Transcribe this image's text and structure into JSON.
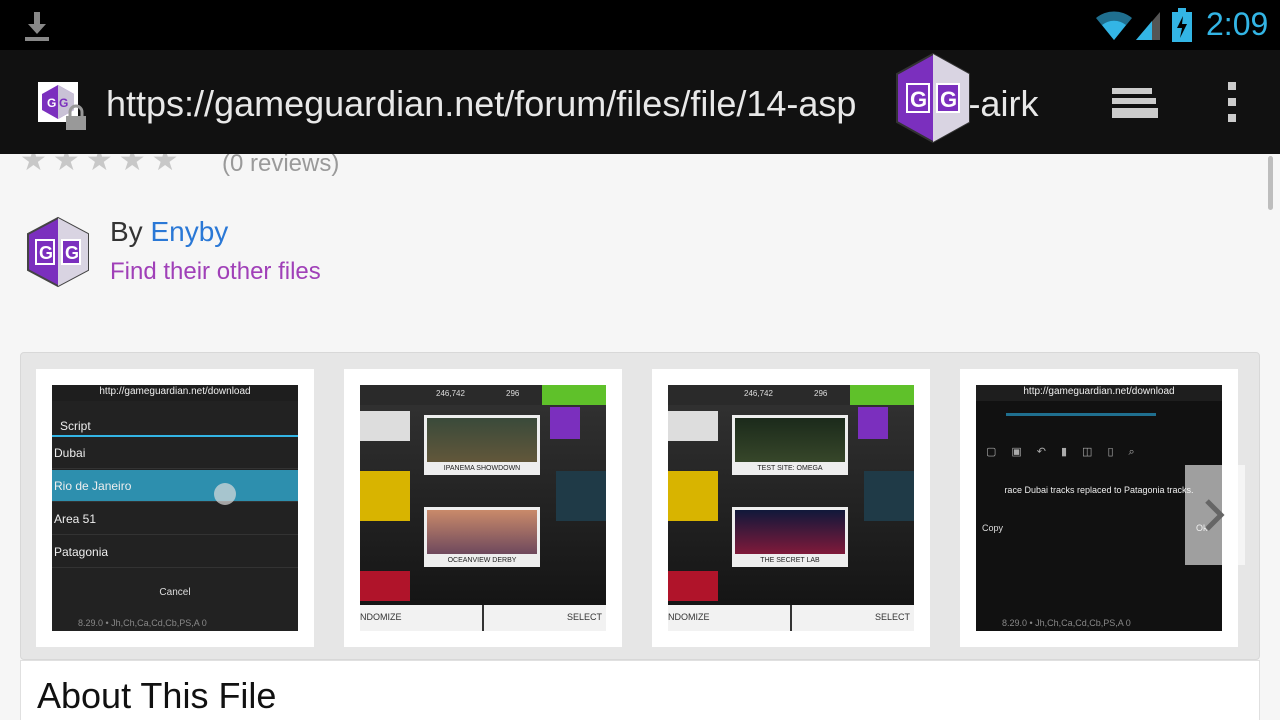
{
  "status_bar": {
    "time": "2:09",
    "icons": [
      "download-icon",
      "wifi-icon",
      "signal-icon",
      "battery-icon"
    ],
    "accent": "#33b5e5"
  },
  "browser": {
    "url": "https://gameguardian.net/forum/files/file/14-asp",
    "url_suffix": "8-airk",
    "icons": [
      "site-favicon",
      "lock-icon",
      "tabs-icon",
      "overflow-menu-icon",
      "gameguardian-overlay-icon"
    ]
  },
  "page": {
    "rating": {
      "stars": 5,
      "filled": 0,
      "reviews": "(0 reviews)"
    },
    "author": {
      "by": "By ",
      "name": "Enyby",
      "other_files": "Find their other files"
    },
    "gallery": {
      "screenshots": [
        {
          "type": "script-menu",
          "url": "http://gameguardian.net/download",
          "title": "Script",
          "items": [
            "Dubai",
            "Rio de Janeiro",
            "Area 51",
            "Patagonia"
          ],
          "selected": "Rio de Janeiro",
          "cancel": "Cancel",
          "footer": "8.29.0  •  Jh,Ch,Ca,Cd,Cb,PS,A  0"
        },
        {
          "type": "game",
          "score_left": "246,742",
          "score_right": "296",
          "card_top": "IPANEMA SHOWDOWN",
          "card_bottom": "OCEANVIEW DERBY",
          "bottom_left": "NDOMIZE",
          "bottom_right": "SELECT"
        },
        {
          "type": "game",
          "score_left": "246,742",
          "score_right": "296",
          "card_top": "TEST SITE: OMEGA",
          "card_bottom": "THE SECRET LAB",
          "bottom_left": "NDOMIZE",
          "bottom_right": "SELECT"
        },
        {
          "type": "copy-dialog",
          "url": "http://gameguardian.net/download",
          "message": "race Dubai tracks replaced to Patagonia tracks.",
          "copy": "Copy",
          "ok": "Ok",
          "footer": "8.29.0  •  Jh,Ch,Ca,Cd,Cb,PS,A  0"
        }
      ]
    },
    "about": {
      "title": "About This File"
    }
  },
  "colors": {
    "link_blue": "#2a78d6",
    "link_purple": "#a040b8",
    "gg_purple": "#7b2fbe"
  }
}
